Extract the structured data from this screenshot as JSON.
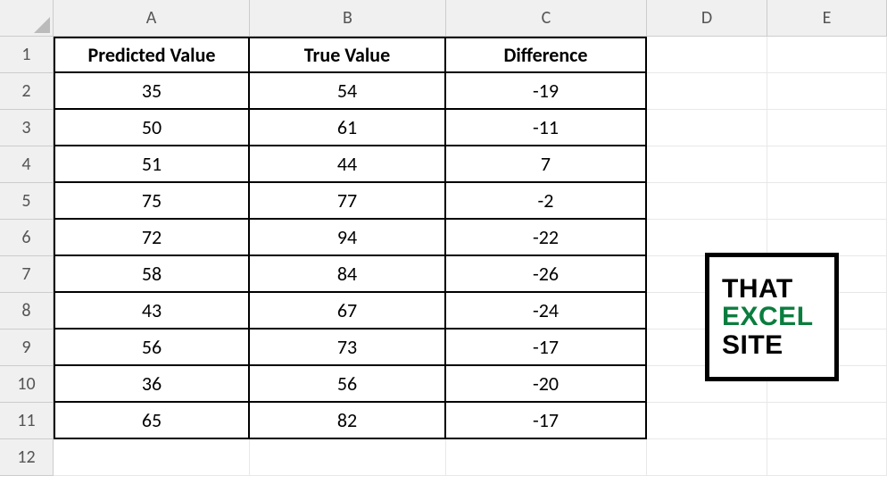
{
  "columns": [
    "A",
    "B",
    "C",
    "D",
    "E"
  ],
  "rows": [
    "1",
    "2",
    "3",
    "4",
    "5",
    "6",
    "7",
    "8",
    "9",
    "10",
    "11",
    "12"
  ],
  "headers": {
    "A": "Predicted Value",
    "B": "True Value",
    "C": "Difference"
  },
  "data": [
    {
      "A": "35",
      "B": "54",
      "C": "-19"
    },
    {
      "A": "50",
      "B": "61",
      "C": "-11"
    },
    {
      "A": "51",
      "B": "44",
      "C": "7"
    },
    {
      "A": "75",
      "B": "77",
      "C": "-2"
    },
    {
      "A": "72",
      "B": "94",
      "C": "-22"
    },
    {
      "A": "58",
      "B": "84",
      "C": "-26"
    },
    {
      "A": "43",
      "B": "67",
      "C": "-24"
    },
    {
      "A": "56",
      "B": "73",
      "C": "-17"
    },
    {
      "A": "36",
      "B": "56",
      "C": "-20"
    },
    {
      "A": "65",
      "B": "82",
      "C": "-17"
    }
  ],
  "logo": {
    "line1": "THAT",
    "line2": "EXCEL",
    "line3": "SITE"
  }
}
